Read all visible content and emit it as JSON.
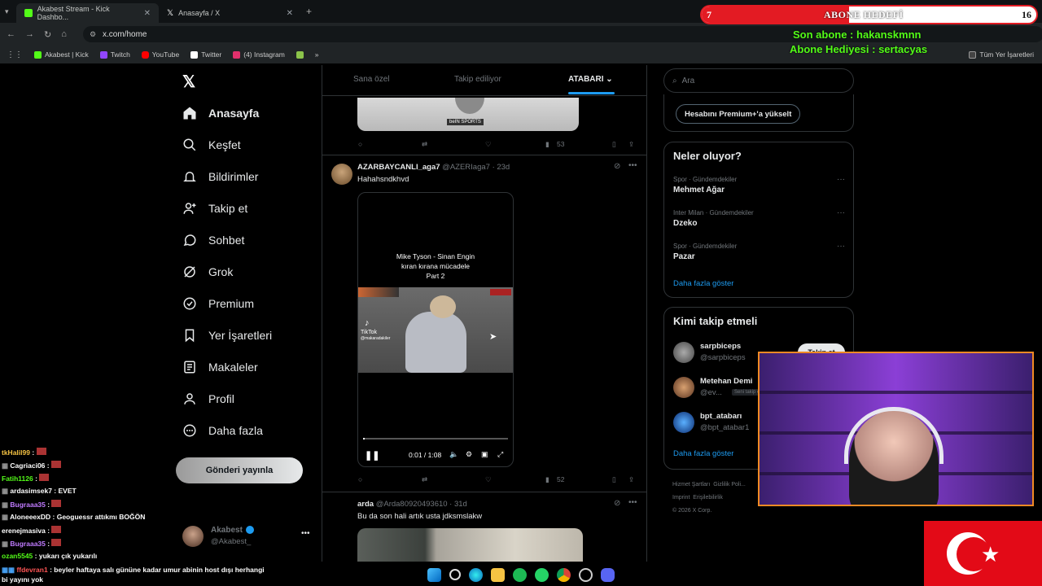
{
  "browser": {
    "tabs": [
      {
        "label": "Akabest Stream - Kick Dashbo...",
        "favicon_color": "#53fc18"
      },
      {
        "label": "Anasayfa / X",
        "favicon_color": "#ffffff"
      }
    ],
    "address": "x.com/home",
    "bookmarks": [
      {
        "label": "Akabest | Kick",
        "color": "#53fc18"
      },
      {
        "label": "Twitch",
        "color": "#9146ff"
      },
      {
        "label": "YouTube",
        "color": "#ff0000"
      },
      {
        "label": "Twitter",
        "color": "#ffffff"
      },
      {
        "label": "(4) Instagram",
        "color": "#e1306c"
      }
    ],
    "all_bookmarks": "Tüm Yer İşaretleri"
  },
  "overlay": {
    "goal_title": "ABONE HEDEFİ",
    "goal_current": "7",
    "goal_target": "16",
    "last_sub": "Son abone : hakanskmnn",
    "gift_sub": "Abone Hediyesi : sertacyas"
  },
  "nav": {
    "items": [
      {
        "label": "Anasayfa",
        "icon": "home-icon"
      },
      {
        "label": "Keşfet",
        "icon": "search-icon"
      },
      {
        "label": "Bildirimler",
        "icon": "bell-icon"
      },
      {
        "label": "Takip et",
        "icon": "add-person-icon"
      },
      {
        "label": "Sohbet",
        "icon": "chat-icon"
      },
      {
        "label": "Grok",
        "icon": "grok-icon"
      },
      {
        "label": "Premium",
        "icon": "premium-icon"
      },
      {
        "label": "Yer İşaretleri",
        "icon": "bookmark-icon"
      },
      {
        "label": "Makaleler",
        "icon": "article-icon"
      },
      {
        "label": "Profil",
        "icon": "person-icon"
      },
      {
        "label": "Daha fazla",
        "icon": "more-icon"
      }
    ],
    "post_button": "Gönderi yayınla",
    "account_name": "Akabest",
    "account_handle": "@Akabest_"
  },
  "feed": {
    "tabs": [
      "Sana özel",
      "Takip ediliyor",
      "ATABARI"
    ],
    "tweet0": {
      "views": "53",
      "media_caption": "beIN SPORTS"
    },
    "tweet1": {
      "name": "AZARBAYCANLI_aga7",
      "handle": "@AZERIaga7 · 23d",
      "text": "Hahahsndkhvd",
      "video_caption_lines": [
        "Mike Tyson - Sinan Engin",
        "kıran kırana mücadele",
        "Part 2"
      ],
      "tiktok_label": "TikTok",
      "tiktok_handle": "@makaradakiler",
      "time": "0:01 / 1:08",
      "progress": 0.013,
      "views": "52"
    },
    "tweet2": {
      "name": "arda",
      "handle": "@Arda80920493610 · 31d",
      "text": "Bu da son hali artık usta jdksmslakw"
    }
  },
  "right": {
    "search_placeholder": "Ara",
    "premium_button": "Hesabını Premium+'a yükselt",
    "trending_title": "Neler oluyor?",
    "trends": [
      {
        "meta": "Spor · Gündemdekiler",
        "name": "Mehmet Ağar"
      },
      {
        "meta": "Inter Milan · Gündemdekiler",
        "name": "Dzeko"
      },
      {
        "meta": "Spor · Gündemdekiler",
        "name": "Pazar"
      }
    ],
    "show_more": "Daha fazla göster",
    "follow_title": "Kimi takip etmeli",
    "suggestions": [
      {
        "name": "sarpbiceps",
        "handle": "@sarpbiceps"
      },
      {
        "name": "Metehan Demi",
        "handle": "@ev...",
        "badge": "Seni takip e..."
      },
      {
        "name": "bpt_atabarı",
        "handle": "@bpt_atabar1"
      }
    ],
    "follow_label": "Takip et",
    "show_more2": "Daha fazla göster",
    "footer": [
      "Hizmet Şartları",
      "Gizlilik Poli...",
      "Imprint",
      "Erişilebilirlik",
      "© 2026 X Corp."
    ]
  },
  "chat": [
    {
      "user": "tkHalil99",
      "color": "#f6c343",
      "msg": ""
    },
    {
      "user": "Cagriaci06",
      "color": "#ffffff",
      "msg": ""
    },
    {
      "user": "Fatih1126",
      "color": "#53fc18",
      "msg": ""
    },
    {
      "user": "ardasimsek7",
      "color": "#ffffff",
      "msg": "EVET"
    },
    {
      "user": "Bugraaa35",
      "color": "#c07bff",
      "msg": ""
    },
    {
      "user": "AloneeexDD",
      "color": "#ffffff",
      "msg": "Geoguessr attıkmı BOĞÖN"
    },
    {
      "user": "erenejmasiva",
      "color": "#ffffff",
      "msg": ""
    },
    {
      "user": "Bugraaa35",
      "color": "#c07bff",
      "msg": ""
    },
    {
      "user": "ozan5545",
      "color": "#53fc18",
      "msg": "yukarı çık yukarılı"
    },
    {
      "user": "ffdevran1",
      "color": "#ff5555",
      "msg": "beyler haftaya salı gününe kadar umur abinin host dışı herhangi bi yayını yok"
    }
  ]
}
